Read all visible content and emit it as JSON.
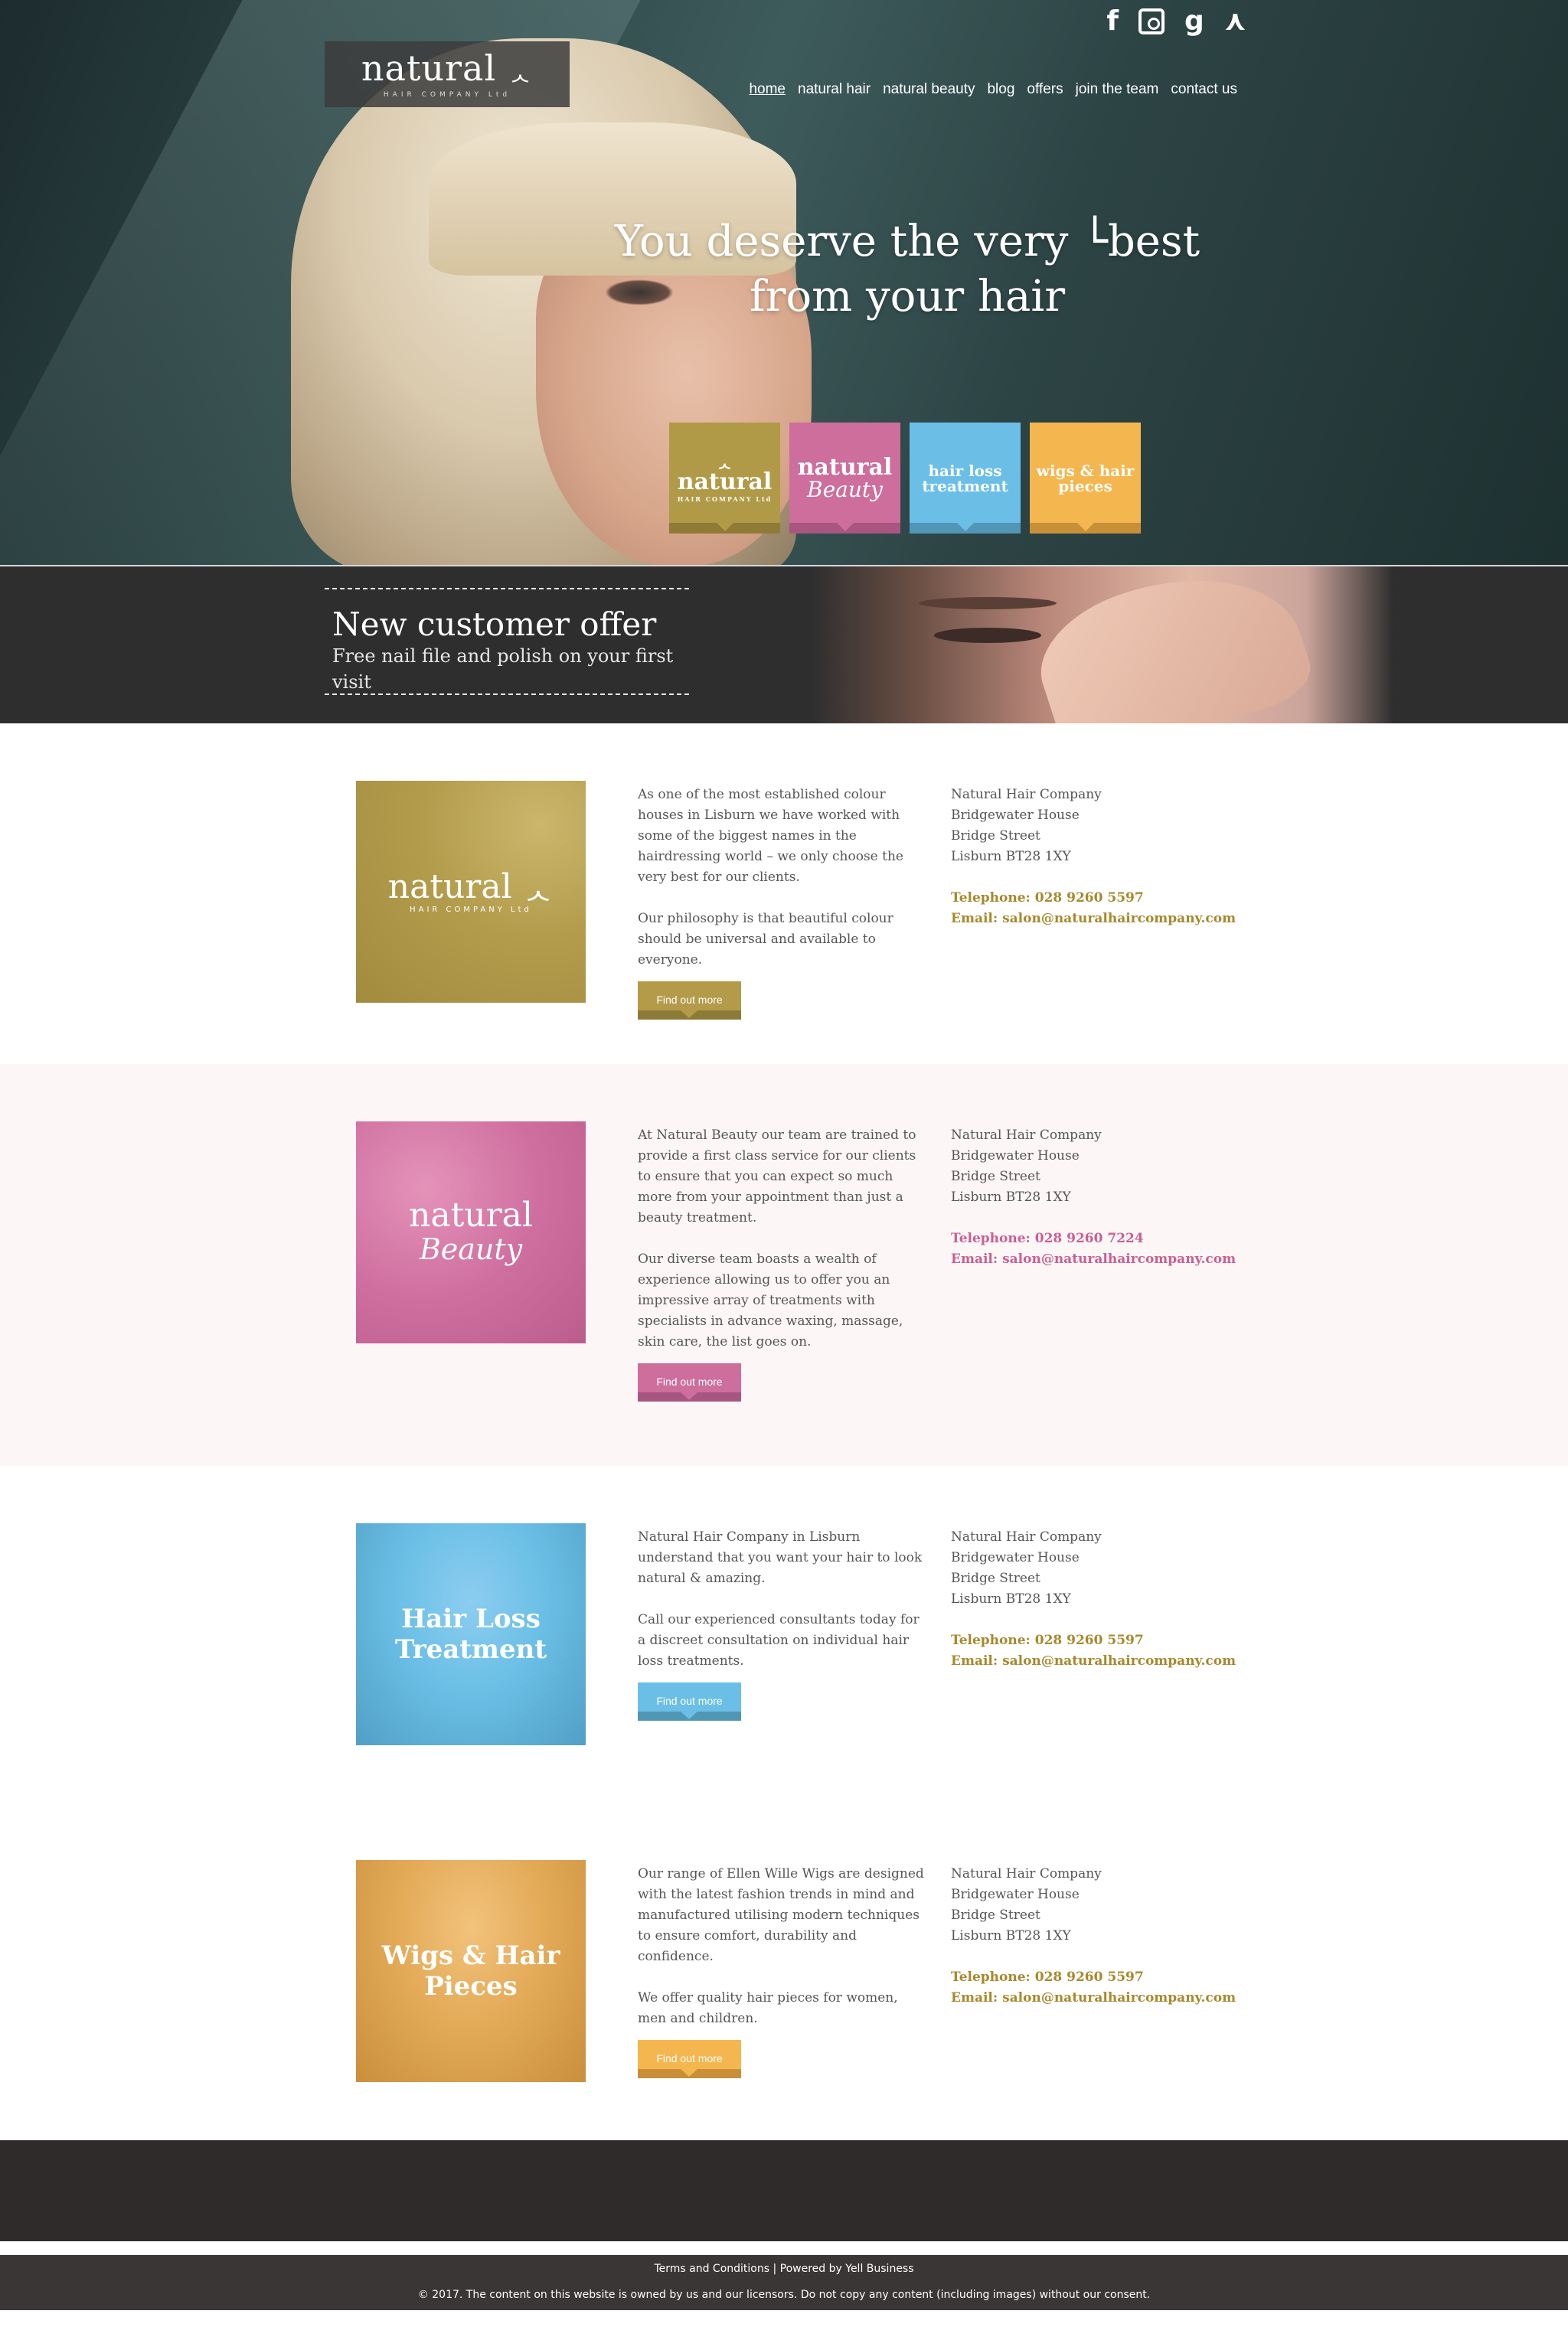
{
  "header": {
    "logo": {
      "word": "natural",
      "sub": "HAIR COMPANY Ltd"
    },
    "social": [
      {
        "name": "facebook",
        "glyph": "f"
      },
      {
        "name": "instagram",
        "glyph": ""
      },
      {
        "name": "google-plus",
        "glyph": "g"
      },
      {
        "name": "yell",
        "glyph": "⋏"
      }
    ],
    "nav": [
      {
        "label": "home",
        "active": true
      },
      {
        "label": "natural hair"
      },
      {
        "label": "natural beauty"
      },
      {
        "label": "blog"
      },
      {
        "label": "offers"
      },
      {
        "label": "join the team"
      },
      {
        "label": "contact us"
      }
    ]
  },
  "hero": {
    "headline_line1": "You deserve the very └best",
    "headline_line2": "from your hair",
    "tiles": {
      "hair": {
        "word": "natural",
        "sub": "HAIR COMPANY Ltd"
      },
      "beauty": {
        "word": "natural",
        "script": "Beauty"
      },
      "loss": {
        "line1": "hair loss",
        "line2": "treatment"
      },
      "wigs": {
        "line1": "wigs & hair",
        "line2": "pieces"
      }
    }
  },
  "offer": {
    "title": "New customer offer",
    "subtitle": "Free nail file and polish on your first visit"
  },
  "sections": {
    "hair": {
      "image": {
        "word": "natural",
        "sub": "HAIR COMPANY Ltd"
      },
      "p1": "As one of the most established colour houses in Lisburn we have worked with some of the biggest names in the hairdressing world – we only choose the very best for our clients.",
      "p2": "Our philosophy is that beautiful colour should be universal and available to everyone.",
      "button": "Find out more",
      "address": [
        "Natural Hair Company",
        "Bridgewater House",
        "Bridge Street",
        "Lisburn BT28 1XY"
      ],
      "telephone": "Telephone: 028 9260 5597",
      "email": "Email: salon@naturalhaircompany.com"
    },
    "beauty": {
      "image": {
        "word": "natural",
        "script": "Beauty"
      },
      "p1": "At Natural Beauty our team are trained to provide a first class service for our clients to ensure that you can expect so much more from your appointment than just a beauty treatment.",
      "p2": "Our diverse team boasts a wealth of experience allowing us to offer you an impressive array of treatments with specialists in advance waxing, massage, skin care, the list goes on.",
      "button": "Find out more",
      "address": [
        "Natural Hair Company",
        "Bridgewater House",
        "Bridge Street",
        "Lisburn BT28 1XY"
      ],
      "telephone": "Telephone: 028 9260 7224",
      "email": "Email: salon@naturalhaircompany.com"
    },
    "loss": {
      "image": {
        "line1": "Hair Loss",
        "line2": "Treatment"
      },
      "p1": "Natural Hair Company in Lisburn understand that you want your hair to look natural & amazing.",
      "p2": "Call our experienced consultants today for a discreet consultation on individual hair loss treatments.",
      "button": "Find out more",
      "address": [
        "Natural Hair Company",
        "Bridgewater House",
        "Bridge Street",
        "Lisburn BT28 1XY"
      ],
      "telephone": "Telephone: 028 9260 5597",
      "email": "Email: salon@naturalhaircompany.com"
    },
    "wigs": {
      "image": {
        "line1": "Wigs & Hair",
        "line2": "Pieces"
      },
      "p1": "Our range of Ellen Wille Wigs are designed with the latest fashion trends in mind and manufactured utilising modern techniques to ensure comfort, durability and confidence.",
      "p2": "We offer quality hair pieces for women, men and children.",
      "button": "Find out more",
      "address": [
        "Natural Hair Company",
        "Bridgewater House",
        "Bridge Street",
        "Lisburn BT28 1XY"
      ],
      "telephone": "Telephone: 028 9260 5597",
      "email": "Email: salon@naturalhaircompany.com"
    }
  },
  "footer": {
    "terms": "Terms and Conditions",
    "separator": " | ",
    "powered": "Powered by Yell Business",
    "copyright": "© 2017. The content on this website is owned by us and our licensors. Do not copy any content (including images) without our consent."
  },
  "colors": {
    "gold": "#b39b4a",
    "pink": "#cd6e9d",
    "blue": "#6bbfe6",
    "orange": "#f4b64f",
    "gold_text": "#a7882d",
    "pink_text": "#c95f93"
  }
}
